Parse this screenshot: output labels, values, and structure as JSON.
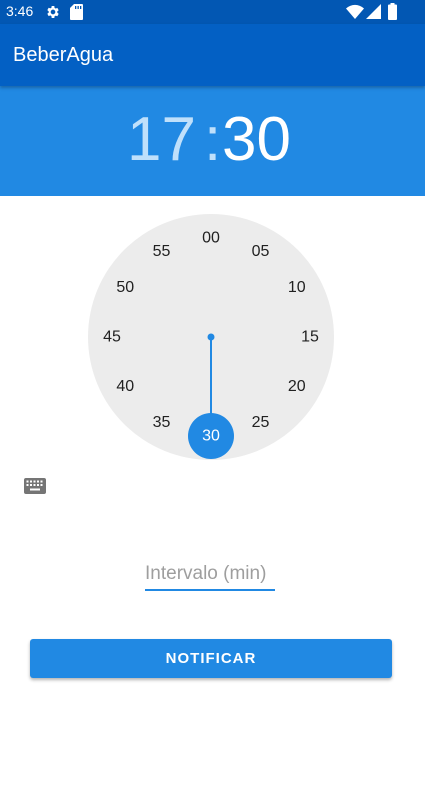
{
  "status_bar": {
    "time": "3:46",
    "left_icons": [
      "settings-icon",
      "sd-card-icon"
    ],
    "right_icons": [
      "wifi-icon",
      "signal-icon",
      "battery-icon"
    ]
  },
  "app_bar": {
    "title": "BeberAgua"
  },
  "time_picker": {
    "hour": "17",
    "separator": ":",
    "minute": "30",
    "colors": {
      "header": "#2189e3",
      "hour_text": "#bfe0fb",
      "minute_text": "#ffffff",
      "accent": "#2189e3"
    },
    "dial_labels": [
      "00",
      "05",
      "10",
      "15",
      "20",
      "25",
      "30",
      "35",
      "40",
      "45",
      "50",
      "55"
    ],
    "selected_label": "30"
  },
  "interval_field": {
    "value": "",
    "placeholder": "Intervalo (min)"
  },
  "notify_button": {
    "label": "NOTIFICAR"
  }
}
